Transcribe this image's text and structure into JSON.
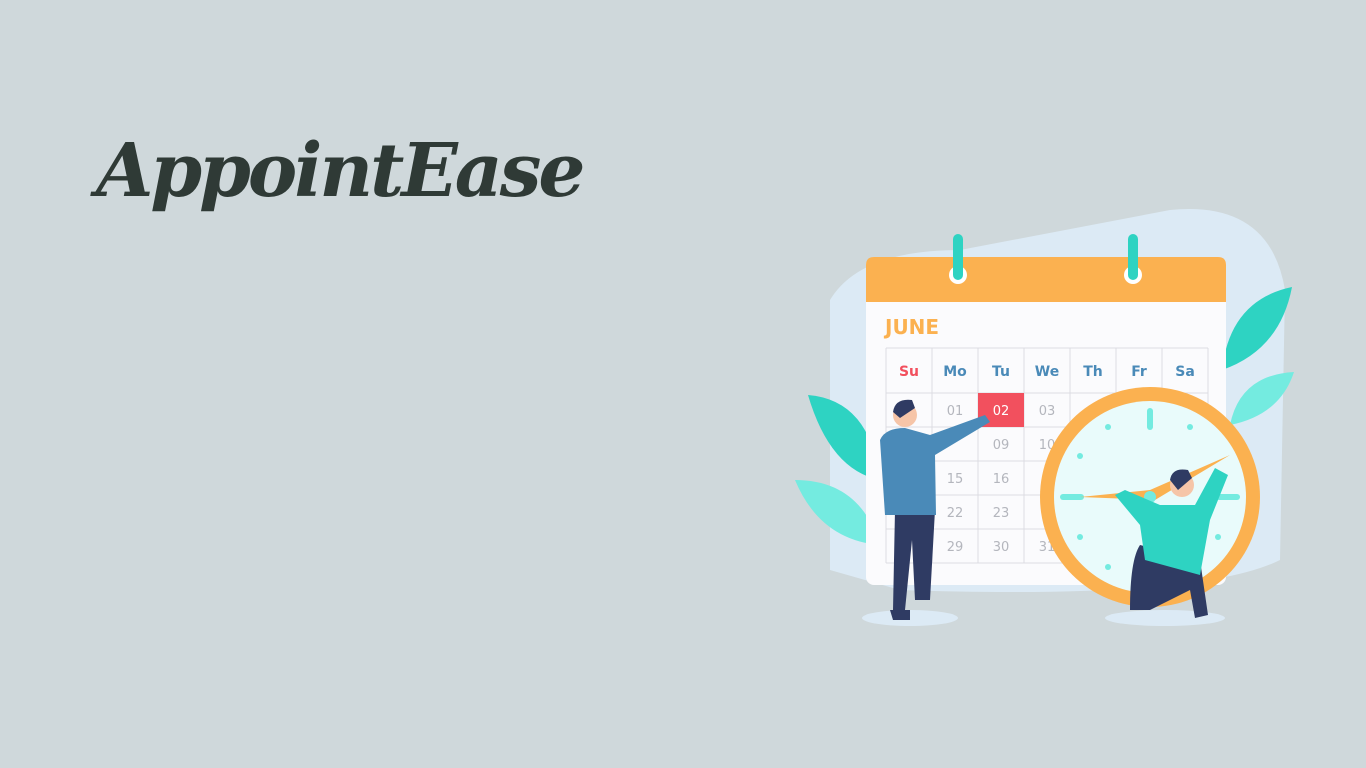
{
  "app": {
    "logo_text": "AppointEase"
  },
  "illustration": {
    "month": "JUNE",
    "weekdays": [
      "Su",
      "Mo",
      "Tu",
      "We",
      "Th",
      "Fr",
      "Sa"
    ],
    "dates": [
      {
        "label": "01",
        "row": 0,
        "col": 1
      },
      {
        "label": "02",
        "row": 0,
        "col": 2,
        "highlight": true
      },
      {
        "label": "03",
        "row": 0,
        "col": 3
      },
      {
        "label": "09",
        "row": 1,
        "col": 2
      },
      {
        "label": "10",
        "row": 1,
        "col": 3
      },
      {
        "label": "15",
        "row": 2,
        "col": 1
      },
      {
        "label": "16",
        "row": 2,
        "col": 2
      },
      {
        "label": "22",
        "row": 3,
        "col": 1
      },
      {
        "label": "23",
        "row": 3,
        "col": 2
      },
      {
        "label": "29",
        "row": 4,
        "col": 1
      },
      {
        "label": "30",
        "row": 4,
        "col": 2
      },
      {
        "label": "31",
        "row": 4,
        "col": 3
      }
    ],
    "colors": {
      "orange": "#fbb150",
      "teal": "#2ed3c2",
      "red": "#f2505e",
      "blue": "#4a8ab8",
      "navy": "#2f3b63"
    }
  }
}
